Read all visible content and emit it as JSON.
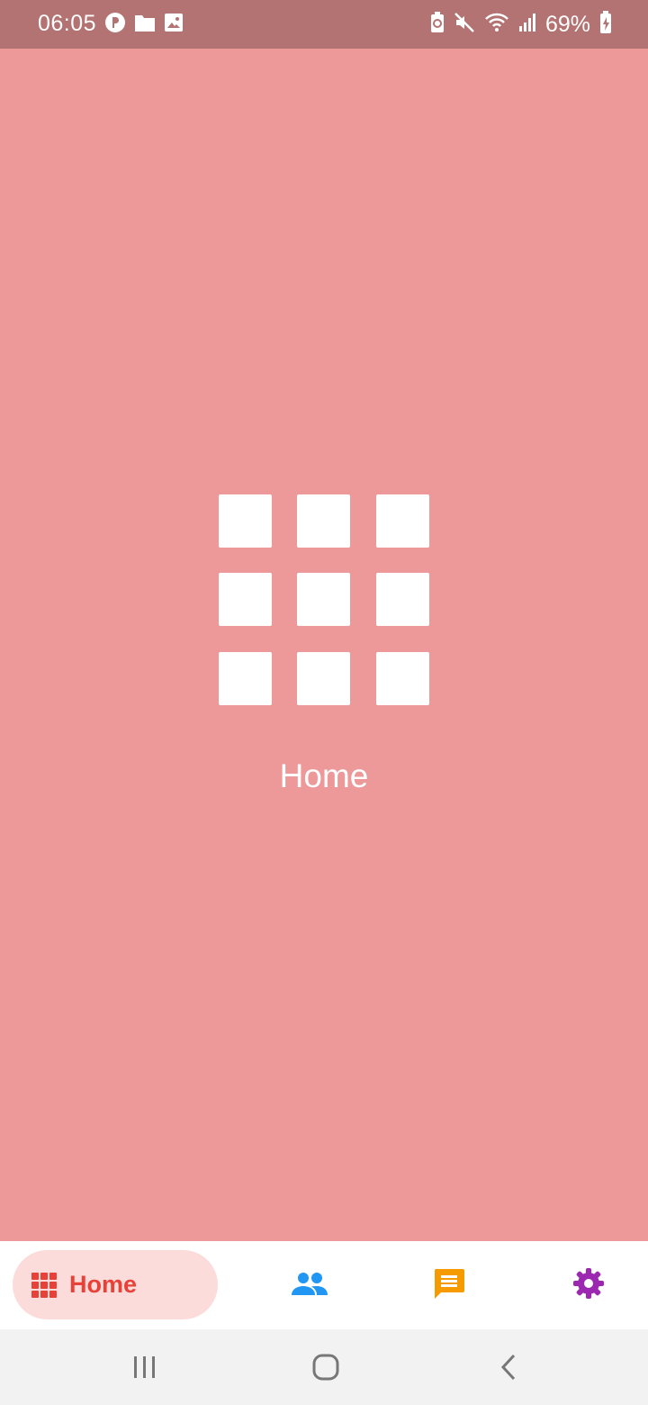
{
  "status_bar": {
    "time": "06:05",
    "battery_percent": "69%",
    "background_color": "#b37372",
    "left_icons": [
      "pi-app-icon",
      "folder-icon",
      "image-icon"
    ],
    "right_icons": [
      "battery-saver-icon",
      "mute-icon",
      "wifi-icon",
      "signal-icon",
      "battery-charging-icon"
    ]
  },
  "main": {
    "background_color": "#ed9899",
    "icon": "grid-icon",
    "label": "Home"
  },
  "bottom_nav": {
    "items": [
      {
        "id": "home",
        "label": "Home",
        "icon": "grid-icon",
        "color": "#e84238",
        "selected": true
      },
      {
        "id": "people",
        "label": "",
        "icon": "people-icon",
        "color": "#2196f3",
        "selected": false
      },
      {
        "id": "messages",
        "label": "",
        "icon": "chat-icon",
        "color": "#f59b00",
        "selected": false
      },
      {
        "id": "settings",
        "label": "",
        "icon": "gear-icon",
        "color": "#9c27b0",
        "selected": false
      }
    ]
  },
  "system_nav": {
    "buttons": [
      "recents-icon",
      "home-icon",
      "back-icon"
    ]
  }
}
